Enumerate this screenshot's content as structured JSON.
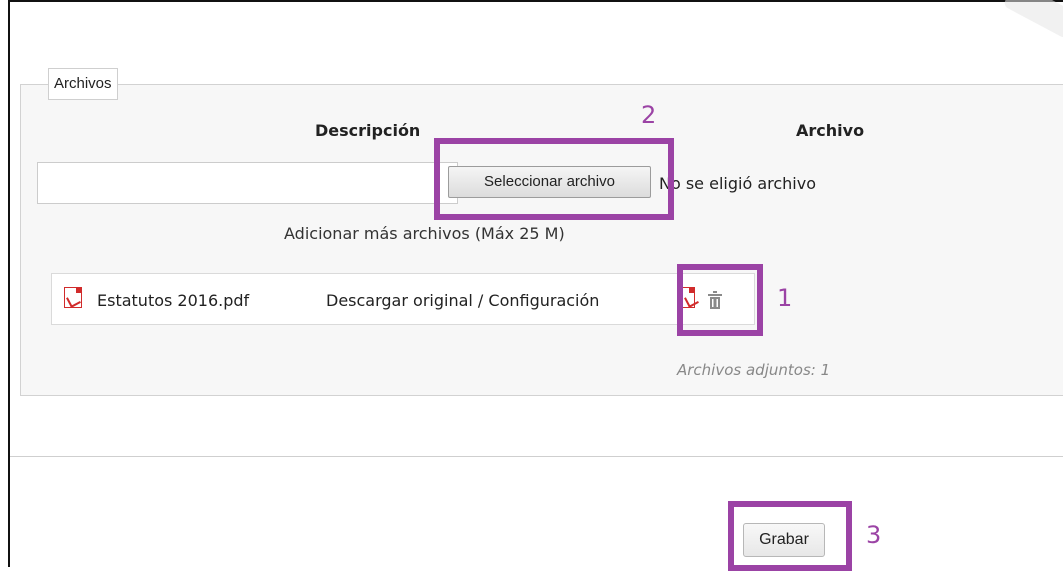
{
  "section": {
    "legend": "Archivos",
    "description_header": "Descripción",
    "file_header": "Archivo",
    "description_value": "",
    "select_file_button": "Seleccionar archivo",
    "no_file_text": "No se eligió archivo",
    "add_more_text": "Adicionar más archivos (Máx 25 M)"
  },
  "attachment": {
    "file_name": "Estatutos 2016.pdf",
    "action_text": "Descargar original / Configuración",
    "icons": [
      "pdf-icon",
      "pdf-icon",
      "trash-icon"
    ]
  },
  "attached_count": "Archivos adjuntos: 1",
  "footer": {
    "save_button": "Grabar"
  },
  "callouts": {
    "number_1": "1",
    "number_2": "2",
    "number_3": "3",
    "color": "#9b43a5"
  }
}
